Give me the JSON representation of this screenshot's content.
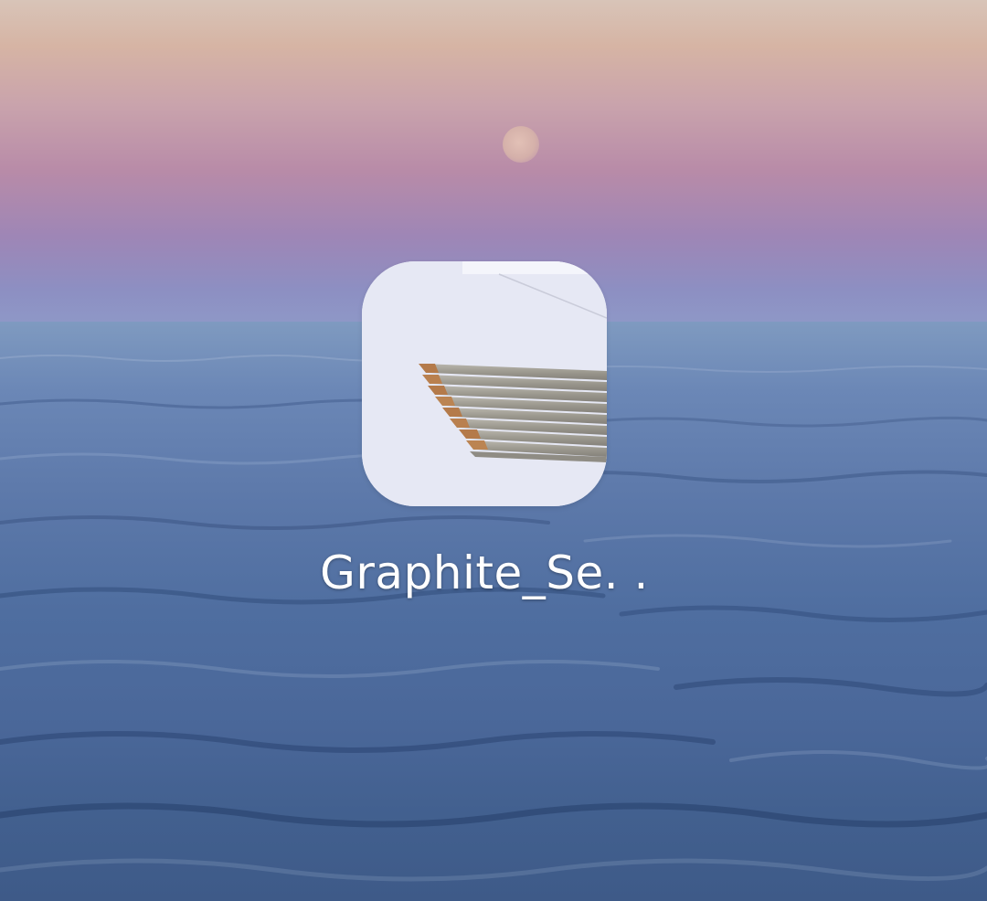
{
  "home_screen": {
    "wallpaper": {
      "description_colors": {
        "sky_top": "#d8c4b8",
        "sky_mid": "#b88ba8",
        "horizon": "#8e99c8",
        "sea": "#4f6ea0"
      }
    },
    "apps": [
      {
        "label": "Graphite_Se. .",
        "icon": "pencils-thumbnail-icon"
      }
    ]
  }
}
